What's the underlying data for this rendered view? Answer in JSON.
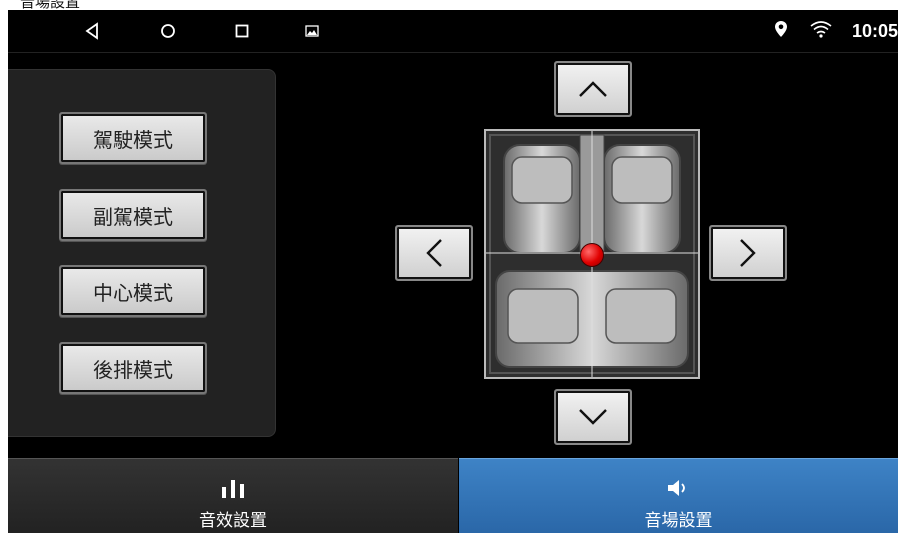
{
  "window": {
    "title": "音場設置"
  },
  "statusbar": {
    "nav": {
      "back": "back-icon",
      "home": "home-icon",
      "recents": "recents-icon",
      "screenshot": "image-icon"
    },
    "location_icon": "location-pin-icon",
    "wifi_icon": "wifi-icon",
    "time": "10:05"
  },
  "modes": [
    {
      "label": "駕駛模式"
    },
    {
      "label": "副駕模式"
    },
    {
      "label": "中心模式"
    },
    {
      "label": "後排模式"
    }
  ],
  "balance": {
    "up_icon": "chevron-up-icon",
    "down_icon": "chevron-down-icon",
    "left_icon": "chevron-left-icon",
    "right_icon": "chevron-right-icon",
    "marker_color": "#e00000"
  },
  "tabs": [
    {
      "label": "音效設置",
      "icon": "equalizer-icon",
      "active": false
    },
    {
      "label": "音場設置",
      "icon": "speaker-icon",
      "active": true
    }
  ],
  "colors": {
    "active_tab": "#2f6fb0",
    "marker": "#e00000"
  }
}
